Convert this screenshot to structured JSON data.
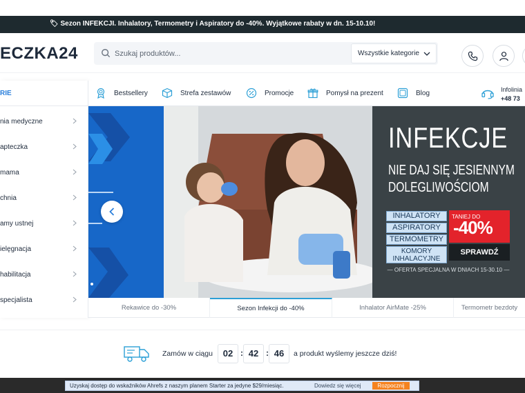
{
  "topbar": {
    "text": "🏷 Sezon INFEKCJI. Inhalatory, Termometry i Aspiratory do -40%. Wyjątkowe rabaty w dn. 15-10.10!"
  },
  "header": {
    "logo": "ECZKA24",
    "search_placeholder": "Szukaj produktów...",
    "category_select": "Wszystkie kategorie"
  },
  "sidebar": {
    "heading": "RIE",
    "items": [
      "nia medyczne",
      " apteczka",
      " mama",
      "chnia",
      "amy ustnej",
      "ielęgnacja",
      "habilitacja",
      "specjalista"
    ]
  },
  "nav": {
    "items": [
      "Bestsellery",
      "Strefa zestawów",
      "Promocje",
      "Pomysł na prezent",
      "Blog"
    ],
    "infolinia_label": "Infolinia",
    "infolinia_phone": "+48 73"
  },
  "banner": {
    "title": "INFEKCJE",
    "subtitle1": "NIE DAJ SIĘ JESIENNYM",
    "subtitle2": "DOLEGLIWOŚCIOM",
    "products": [
      "INHALATORY",
      "ASPIRATORY",
      "TERMOMETRY",
      "KOMORY INHALACYJNE"
    ],
    "promo_small": "TANIEJ DO",
    "promo_big": "-40%",
    "cta": "SPRAWDŹ",
    "offer": "— OFERTA SPECJALNA W DNIACH 15-30.10 —"
  },
  "tabs": [
    {
      "label": "Rekawice do -30%",
      "active": false
    },
    {
      "label": "Sezon Infekcji do -40%",
      "active": true
    },
    {
      "label": "Inhalator AirMate -25%",
      "active": false
    },
    {
      "label": "Termometr bezdoty",
      "active": false
    }
  ],
  "delivery": {
    "text_before": "Zamów w ciągu",
    "hours": "02",
    "minutes": "42",
    "seconds": "46",
    "text_after": "a produkt wyślemy jeszcze dziś!"
  },
  "ahrefs_bar": {
    "message": "Uzyskaj dostęp do wskaźników Ahrefs z naszym planem Starter za jedyne $29/miesiąc.",
    "more": "Dowiedz się więcej",
    "button": "Rozpocznij"
  },
  "colors": {
    "accent": "#2b7fdb",
    "dark": "#1e2a2f",
    "promo_red": "#e3232b",
    "banner_blue": "#1767c8"
  }
}
